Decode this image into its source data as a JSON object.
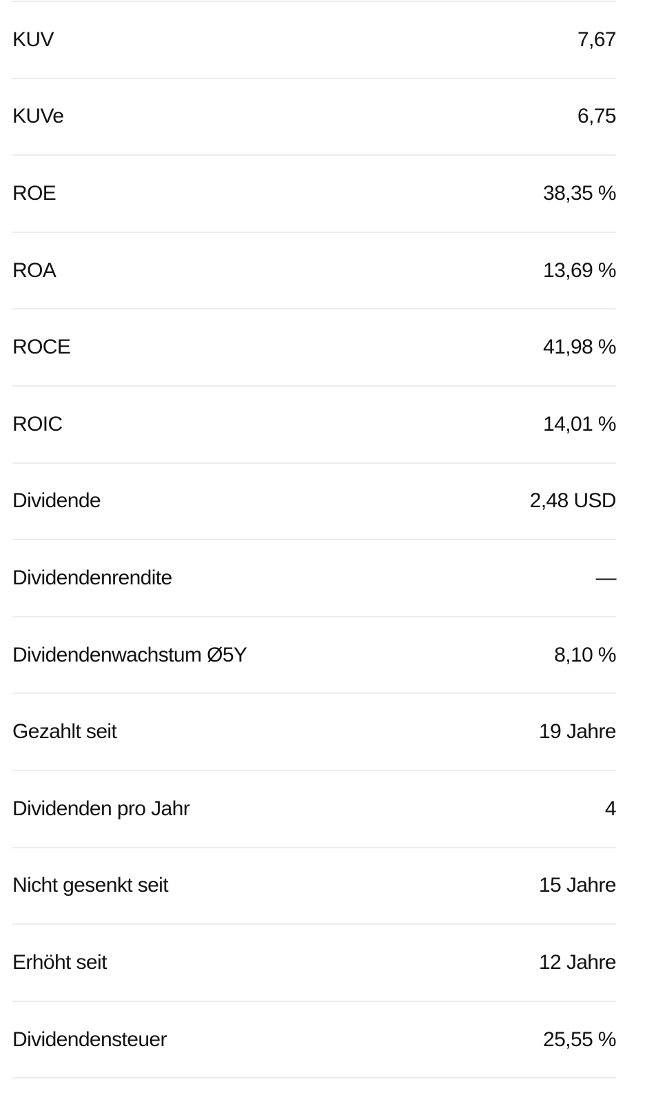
{
  "metrics": [
    {
      "label": "KUV",
      "value": "7,67"
    },
    {
      "label": "KUVe",
      "value": "6,75"
    },
    {
      "label": "ROE",
      "value": "38,35 %"
    },
    {
      "label": "ROA",
      "value": "13,69 %"
    },
    {
      "label": "ROCE",
      "value": "41,98 %"
    },
    {
      "label": "ROIC",
      "value": "14,01 %"
    },
    {
      "label": "Dividende",
      "value": "2,48 USD"
    },
    {
      "label": "Dividendenrendite",
      "value": "—"
    },
    {
      "label": "Dividendenwachstum Ø5Y",
      "value": "8,10 %"
    },
    {
      "label": "Gezahlt seit",
      "value": "19 Jahre"
    },
    {
      "label": "Dividenden pro Jahr",
      "value": "4"
    },
    {
      "label": "Nicht gesenkt seit",
      "value": "15 Jahre"
    },
    {
      "label": "Erhöht seit",
      "value": "12 Jahre"
    },
    {
      "label": "Dividendensteuer",
      "value": "25,55 %"
    }
  ]
}
